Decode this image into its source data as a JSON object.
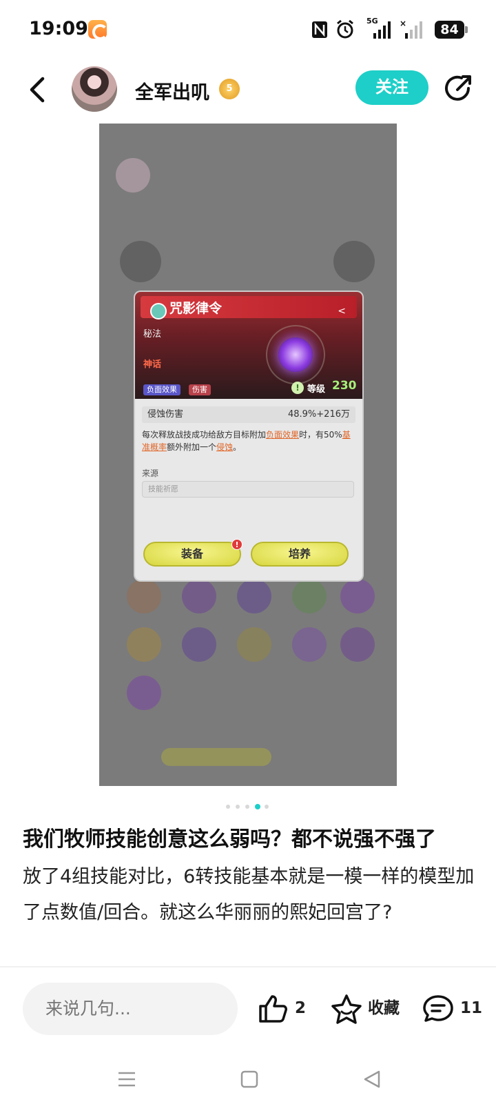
{
  "status_bar": {
    "time": "19:09",
    "battery": "84",
    "network_label": "5G",
    "icons": [
      "app-notification-icon",
      "nfc-icon",
      "alarm-icon",
      "signal-5g-icon",
      "signal-icon",
      "battery-icon"
    ]
  },
  "header": {
    "username": "全军出叽",
    "level_badge": "5",
    "follow_label": "关注"
  },
  "image": {
    "card": {
      "title": "咒影律令",
      "subtitle": "秘法",
      "rarity": "神话",
      "tags": [
        "负面效果",
        "伤害"
      ],
      "level_label": "等级",
      "level_value": "230",
      "stat_name": "侵蚀伤害",
      "stat_value": "48.9%+216万",
      "desc_1": "每次释放战技成功给敌方目标附加",
      "desc_hl1": "负面效果",
      "desc_2": "时，有50%",
      "desc_hl2": "基准概率",
      "desc_3": "额外附加一个",
      "desc_hl3": "侵蚀",
      "desc_4": "。",
      "source_label": "来源",
      "source_value": "技能祈愿",
      "equip_label": "装备",
      "train_label": "培养",
      "equip_alert": "!"
    },
    "pager": {
      "count": 5,
      "active_index": 3
    }
  },
  "post": {
    "title": "我们牧师技能创意这么弱吗？都不说强不强了",
    "body": "放了4组技能对比，6转技能基本就是一模一样的模型加了点数值/回合。就这么华丽丽的熙妃回宫了?"
  },
  "actions": {
    "comment_placeholder": "来说几句...",
    "like_count": "2",
    "favorite_label": "收藏",
    "comment_count": "11"
  },
  "colors": {
    "accent": "#1dcfc8"
  }
}
